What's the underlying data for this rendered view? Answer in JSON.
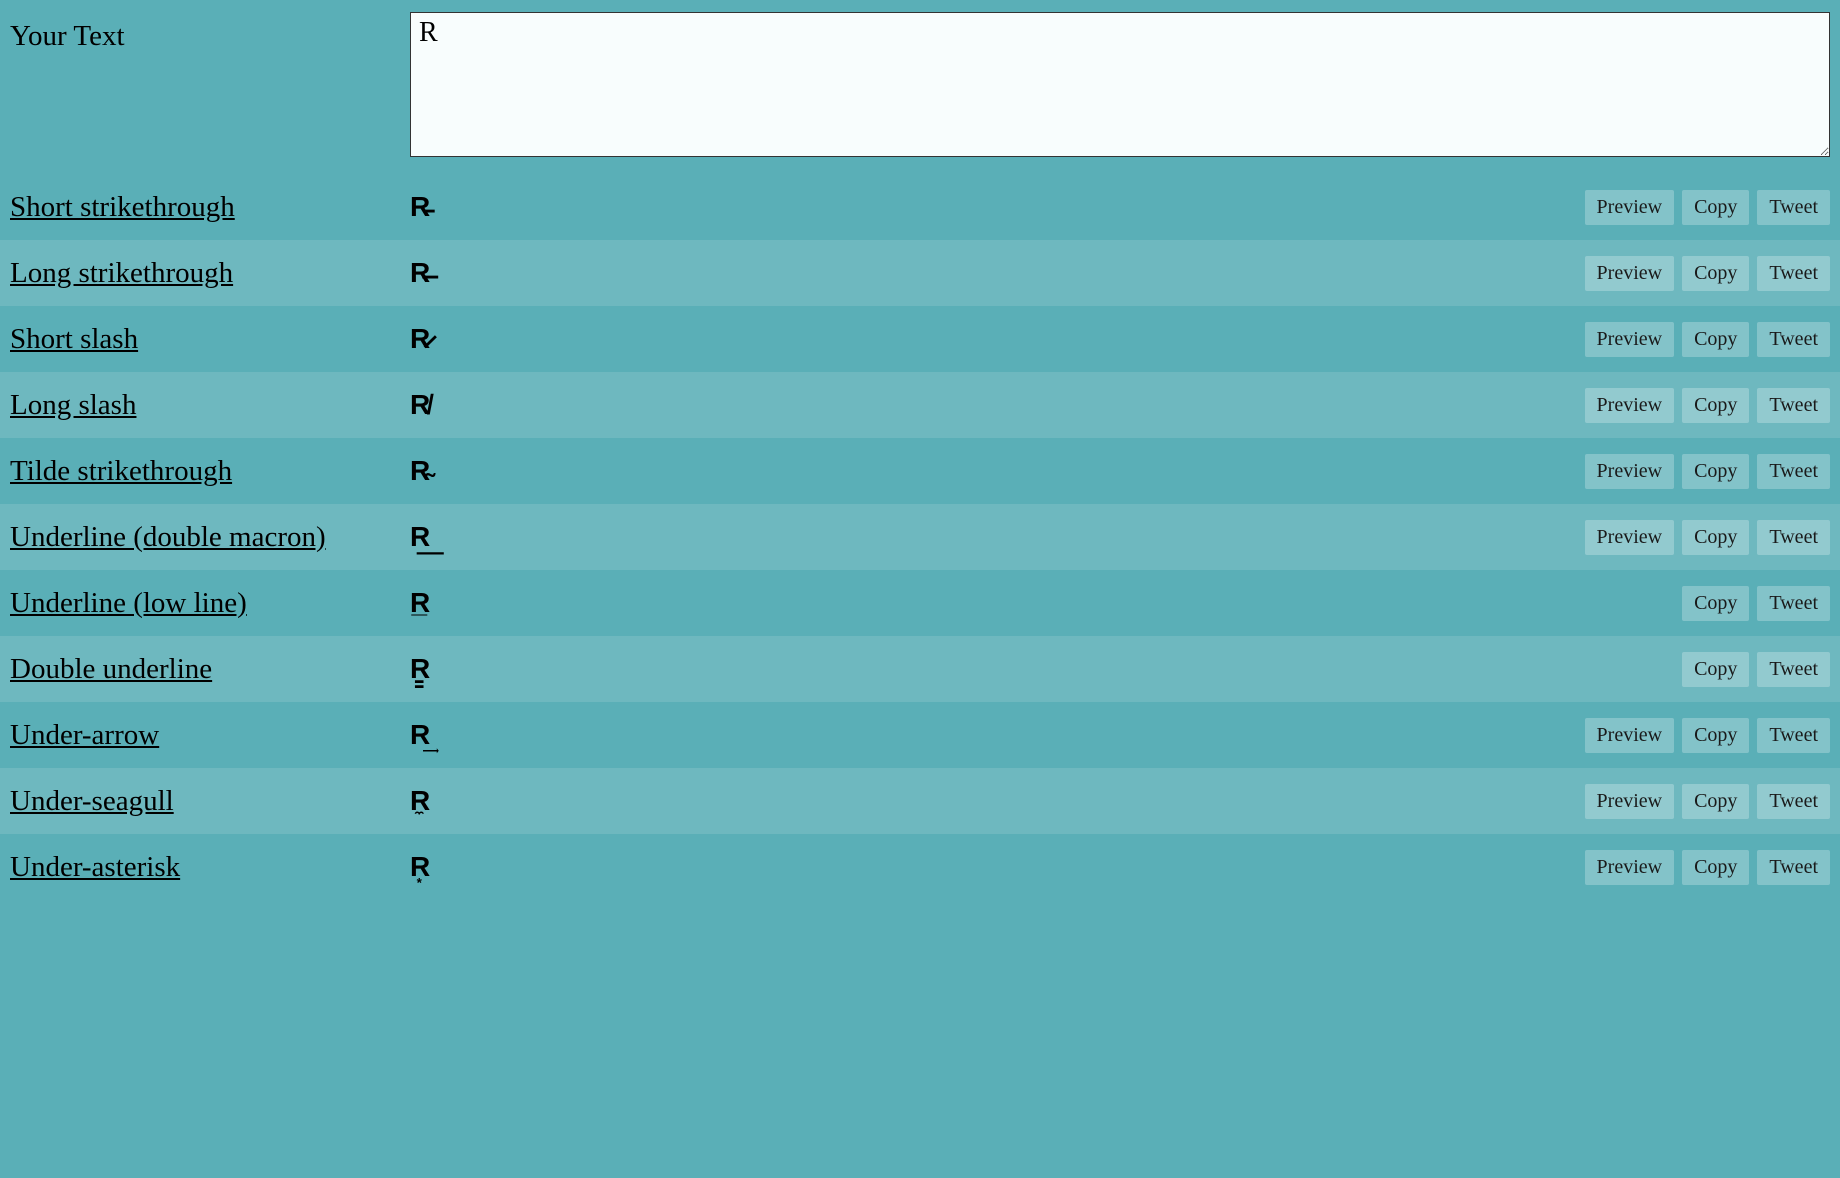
{
  "input": {
    "label": "Your Text",
    "value": "R",
    "placeholder": ""
  },
  "buttons": {
    "preview": "Preview",
    "copy": "Copy",
    "tweet": "Tweet"
  },
  "styles": [
    {
      "name": "Short strikethrough",
      "output": "R̵",
      "preview": true
    },
    {
      "name": "Long strikethrough",
      "output": "R̶",
      "preview": true
    },
    {
      "name": "Short slash",
      "output": "R̷",
      "preview": true
    },
    {
      "name": "Long slash",
      "output": "R̸",
      "preview": true
    },
    {
      "name": "Tilde strikethrough",
      "output": "R̴",
      "preview": true
    },
    {
      "name": "Underline (double macron)",
      "output": "R͟",
      "preview": true
    },
    {
      "name": "Underline (low line)",
      "output": "R̲",
      "preview": false
    },
    {
      "name": "Double underline",
      "output": "R̳",
      "preview": false
    },
    {
      "name": "Under-arrow",
      "output": "R͢",
      "preview": true
    },
    {
      "name": "Under-seagull",
      "output": "R̼",
      "preview": true
    },
    {
      "name": "Under-asterisk",
      "output": "R͙",
      "preview": true
    }
  ]
}
